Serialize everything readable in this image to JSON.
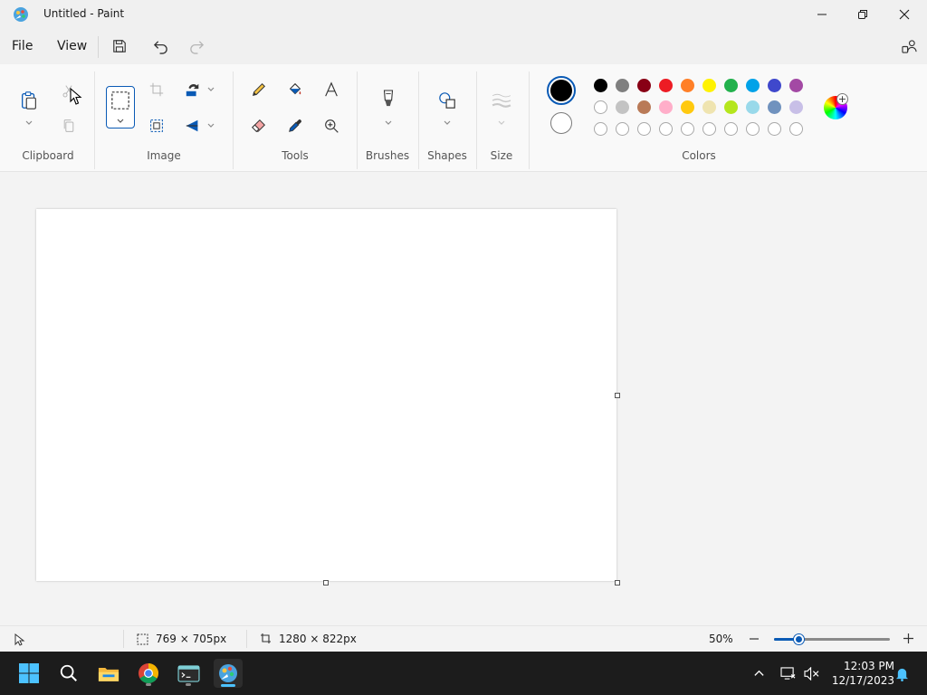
{
  "window": {
    "title": "Untitled - Paint"
  },
  "menu": {
    "file": "File",
    "view": "View"
  },
  "ribbon": {
    "groups": {
      "clipboard": "Clipboard",
      "image": "Image",
      "tools": "Tools",
      "brushes": "Brushes",
      "shapes": "Shapes",
      "size": "Size",
      "colors": "Colors"
    }
  },
  "colors": {
    "primary": "#000000",
    "secondary": "#ffffff",
    "accent": "#0a5ab5",
    "palette_row1": [
      "#000000",
      "#7f7f7f",
      "#880015",
      "#ed1c24",
      "#ff7f27",
      "#fff200",
      "#22b14c",
      "#00a2e8",
      "#3f48cc",
      "#a349a4"
    ],
    "palette_row2": [
      "#ffffff",
      "#c3c3c3",
      "#b97a57",
      "#ffaec9",
      "#ffc90e",
      "#efe4b0",
      "#b5e61d",
      "#99d9ea",
      "#7092be",
      "#c8bfe7"
    ],
    "palette_row3_count_label": "custom-empty"
  },
  "status": {
    "selection_size": "769 × 705px",
    "canvas_size": "1280 × 822px",
    "zoom": "50%",
    "zoom_fraction": 0.22
  },
  "taskbar": {
    "time": "12:03 PM",
    "date": "12/17/2023",
    "apps": [
      "start-icon",
      "search-icon",
      "file-explorer-icon",
      "chrome-icon",
      "terminal-icon",
      "paint-icon"
    ]
  }
}
